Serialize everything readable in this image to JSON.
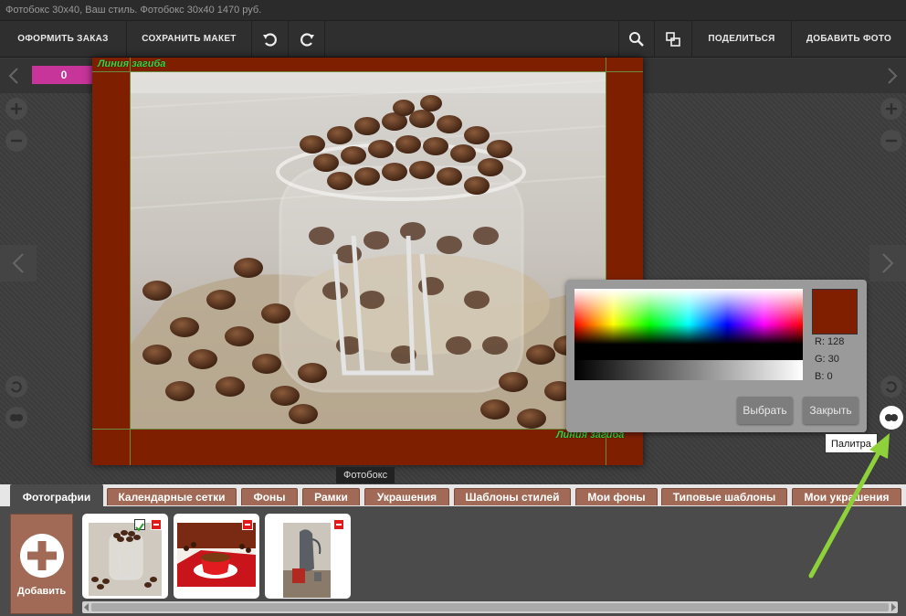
{
  "title_bar": {
    "text": "Фотобокс 30х40, Ваш стиль.  Фотобокс 30х40  1470 руб."
  },
  "toolbar": {
    "order_label": "ОФОРМИТЬ ЗАКАЗ",
    "save_label": "СОХРАНИТЬ МАКЕТ",
    "undo_icon": "undo-icon",
    "redo_icon": "redo-icon",
    "zoom_icon": "search-icon",
    "layout_icon": "layout-icon",
    "share_label": "ПОДЕЛИТЬСЯ",
    "add_photo_label": "ДОБАВИТЬ ФОТО"
  },
  "canvas": {
    "page_counter": "0",
    "fold_line_label": "Линия загиба",
    "product_tooltip": "Фотобокс",
    "frame_color": "#7e2000"
  },
  "palette": {
    "r_label": "R: 128",
    "g_label": "G: 30",
    "b_label": "B: 0",
    "selected_color": "#801e00",
    "select_label": "Выбрать",
    "close_label": "Закрыть",
    "tooltip": "Палитра"
  },
  "tabs": [
    {
      "label": "Фотографии",
      "active": true
    },
    {
      "label": "Календарные сетки"
    },
    {
      "label": "Фоны"
    },
    {
      "label": "Рамки"
    },
    {
      "label": "Украшения"
    },
    {
      "label": "Шаблоны стилей"
    },
    {
      "label": "Мои фоны"
    },
    {
      "label": "Типовые шаблоны"
    },
    {
      "label": "Мои украшения"
    }
  ],
  "photos_panel": {
    "add_label": "Добавить",
    "thumbnails": [
      {
        "name": "coffee-jar",
        "used": true
      },
      {
        "name": "coffee-cup"
      },
      {
        "name": "coffee-pot"
      }
    ]
  },
  "colors": {
    "accent_pink": "#c7349a",
    "tab_brown": "#a16a56",
    "arrow_green": "#8ed13a"
  }
}
